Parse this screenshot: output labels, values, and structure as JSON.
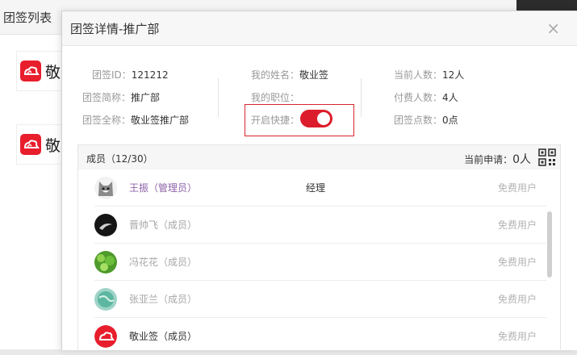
{
  "background": {
    "title": "团签列表",
    "cards": [
      {
        "text": "敬"
      },
      {
        "text": "敬"
      }
    ]
  },
  "dialog": {
    "title": "团签详情-推广部",
    "close": "×"
  },
  "info": {
    "id_label": "团签ID：",
    "id_value": "121212",
    "short_label": "团签简称：",
    "short_value": "推广部",
    "full_label": "团签全称：",
    "full_value": "敬业签推广部",
    "name_label": "我的姓名：",
    "name_value": "敬业签",
    "position_label": "我的职位：",
    "position_value": "",
    "shortcut_label": "开启快捷：",
    "shortcut_on": true,
    "current_label": "当前人数：",
    "current_value": "12人",
    "paid_label": "付费人数：",
    "paid_value": "4人",
    "points_label": "团签点数：",
    "points_value": "0点"
  },
  "members": {
    "header": "成员（12/30）",
    "apply_label": "当前申请：",
    "apply_count": "0人",
    "rows": [
      {
        "name": "王振（管理员）",
        "position": "经理",
        "type": "免费用户",
        "name_color": "#8e62a8"
      },
      {
        "name": "晋帅飞（成员）",
        "position": "",
        "type": "免费用户",
        "name_color": "#a6a6a6"
      },
      {
        "name": "冯花花（成员）",
        "position": "",
        "type": "免费用户",
        "name_color": "#a6a6a6"
      },
      {
        "name": "张亚兰（成员）",
        "position": "",
        "type": "免费用户",
        "name_color": "#a6a6a6"
      },
      {
        "name": "敬业签（成员）",
        "position": "",
        "type": "免费用户",
        "name_color": "#333333"
      }
    ]
  },
  "colors": {
    "accent": "#dc1d2b",
    "admin": "#8e62a8"
  }
}
